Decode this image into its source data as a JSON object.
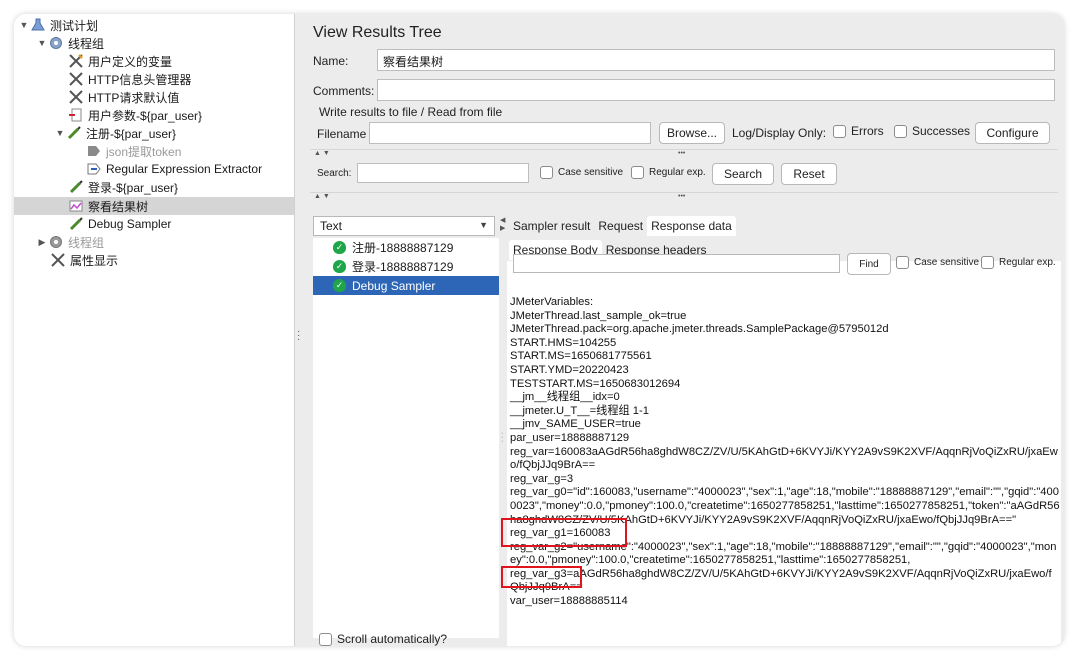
{
  "tree": {
    "items": [
      {
        "label": "测试计划",
        "icon": "flask-icon"
      },
      {
        "label": "线程组",
        "icon": "gear-icon"
      },
      {
        "label": "用户定义的变量",
        "icon": "tools-icon"
      },
      {
        "label": "HTTP信息头管理器",
        "icon": "tools-icon"
      },
      {
        "label": "HTTP请求默认值",
        "icon": "tools-icon"
      },
      {
        "label": "用户参数-${par_user}",
        "icon": "preprocessor-icon"
      },
      {
        "label": "注册-${par_user}",
        "icon": "pipette-icon"
      },
      {
        "label": "json提取token",
        "icon": "extractor-icon"
      },
      {
        "label": "Regular Expression Extractor",
        "icon": "extractor-icon"
      },
      {
        "label": "登录-${par_user}",
        "icon": "pipette-icon"
      },
      {
        "label": "察看结果树",
        "icon": "chart-icon"
      },
      {
        "label": "Debug Sampler",
        "icon": "pipette-icon"
      },
      {
        "label": "线程组",
        "icon": "gear-icon"
      },
      {
        "label": "属性显示",
        "icon": "tools-icon"
      }
    ]
  },
  "panel": {
    "title": "View Results Tree",
    "name_label": "Name:",
    "name_value": "察看结果树",
    "comments_label": "Comments:",
    "write_results_label": "Write results to file / Read from file",
    "filename_label": "Filename",
    "browse_button": "Browse...",
    "log_display_label": "Log/Display Only:",
    "errors_label": "Errors",
    "successes_label": "Successes",
    "configure_button": "Configure",
    "search_label": "Search:",
    "case_sensitive_label": "Case sensitive",
    "regular_exp_label": "Regular exp.",
    "search_button": "Search",
    "reset_button": "Reset"
  },
  "results": {
    "renderer": "Text",
    "samples": [
      {
        "label": "注册-18888887129",
        "status": "success"
      },
      {
        "label": "登录-18888887129",
        "status": "success"
      },
      {
        "label": "Debug Sampler",
        "status": "success"
      }
    ],
    "scroll_automatically": "Scroll automatically?",
    "tabs": [
      "Sampler result",
      "Request",
      "Response data"
    ],
    "subtabs": [
      "Response Body",
      "Response headers"
    ],
    "find_button": "Find",
    "case_sensitive_label": "Case sensitive",
    "regular_exp_label": "Regular exp.",
    "response_text": "JMeterVariables:\nJMeterThread.last_sample_ok=true\nJMeterThread.pack=org.apache.jmeter.threads.SamplePackage@5795012d\nSTART.HMS=104255\nSTART.MS=1650681775561\nSTART.YMD=20220423\nTESTSTART.MS=1650683012694\n__jm__线程组__idx=0\n__jmeter.U_T__=线程组 1-1\n__jmv_SAME_USER=true\npar_user=18888887129\nreg_var=160083aAGdR56ha8ghdW8CZ/ZV/U/5KAhGtD+6KVYJi/KYY2A9vS9K2XVF/AqqnRjVoQiZxRU/jxaEwo/fQbjJJq9BrA==\nreg_var_g=3\nreg_var_g0=\"id\":160083,\"username\":\"4000023\",\"sex\":1,\"age\":18,\"mobile\":\"18888887129\",\"email\":\"\",\"gqid\":\"4000023\",\"money\":0.0,\"pmoney\":100.0,\"createtime\":1650277858251,\"lasttime\":1650277858251,\"token\":\"aAGdR56ha8ghdW8CZ/ZV/U/5KAhGtD+6KVYJi/KYY2A9vS9K2XVF/AqqnRjVoQiZxRU/jxaEwo/fQbjJJq9BrA==\"\nreg_var_g1=160083\nreg_var_g2=\"username\":\"4000023\",\"sex\":1,\"age\":18,\"mobile\":\"18888887129\",\"email\":\"\",\"gqid\":\"4000023\",\"money\":0.0,\"pmoney\":100.0,\"createtime\":1650277858251,\"lasttime\":1650277858251,\nreg_var_g3=aAGdR56ha8ghdW8CZ/ZV/U/5KAhGtD+6KVYJi/KYY2A9vS9K2XVF/AqqnRjVoQiZxRU/jxaEwo/fQbjJJq9BrA==\nvar_user=18888885114"
  },
  "colors": {
    "selection": "#2d66b6",
    "success": "#1fa54a",
    "highlight": "#e0141c"
  }
}
